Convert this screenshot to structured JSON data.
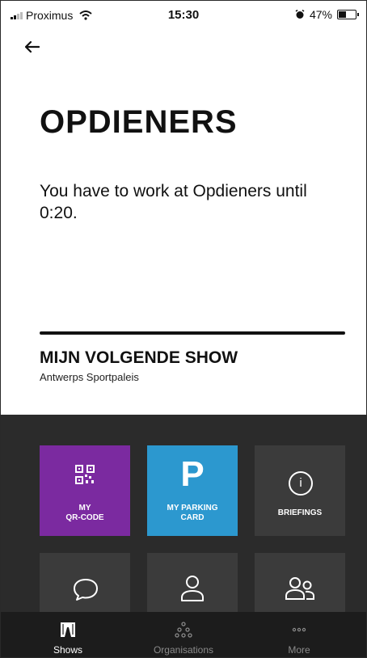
{
  "status_bar": {
    "carrier": "Proximus",
    "time": "15:30",
    "battery": "47%"
  },
  "header": {
    "back_icon": "arrow-left-icon"
  },
  "main": {
    "title": "OPDIENERS",
    "message": "You have to work at Opdieners until 0:20.",
    "next_show_heading": "MIJN VOLGENDE SHOW",
    "next_show_venue": "Antwerps Sportpaleis"
  },
  "tiles": [
    {
      "line1": "MY",
      "line2": "QR-CODE",
      "icon": "qr-code-icon",
      "color": "#7b2aa0"
    },
    {
      "line1": "MY PARKING",
      "line2": "CARD",
      "icon": "parking-icon",
      "glyph": "P",
      "color": "#2c98cf"
    },
    {
      "label": "BRIEFINGS",
      "icon": "info-icon",
      "glyph": "i"
    },
    {
      "icon": "chat-bubble-icon"
    },
    {
      "icon": "user-icon"
    },
    {
      "icon": "users-icon"
    }
  ],
  "bottom_nav": [
    {
      "label": "Shows",
      "icon": "shows-icon",
      "active": true
    },
    {
      "label": "Organisations",
      "icon": "organisations-icon",
      "active": false
    },
    {
      "label": "More",
      "icon": "more-icon",
      "active": false
    }
  ]
}
